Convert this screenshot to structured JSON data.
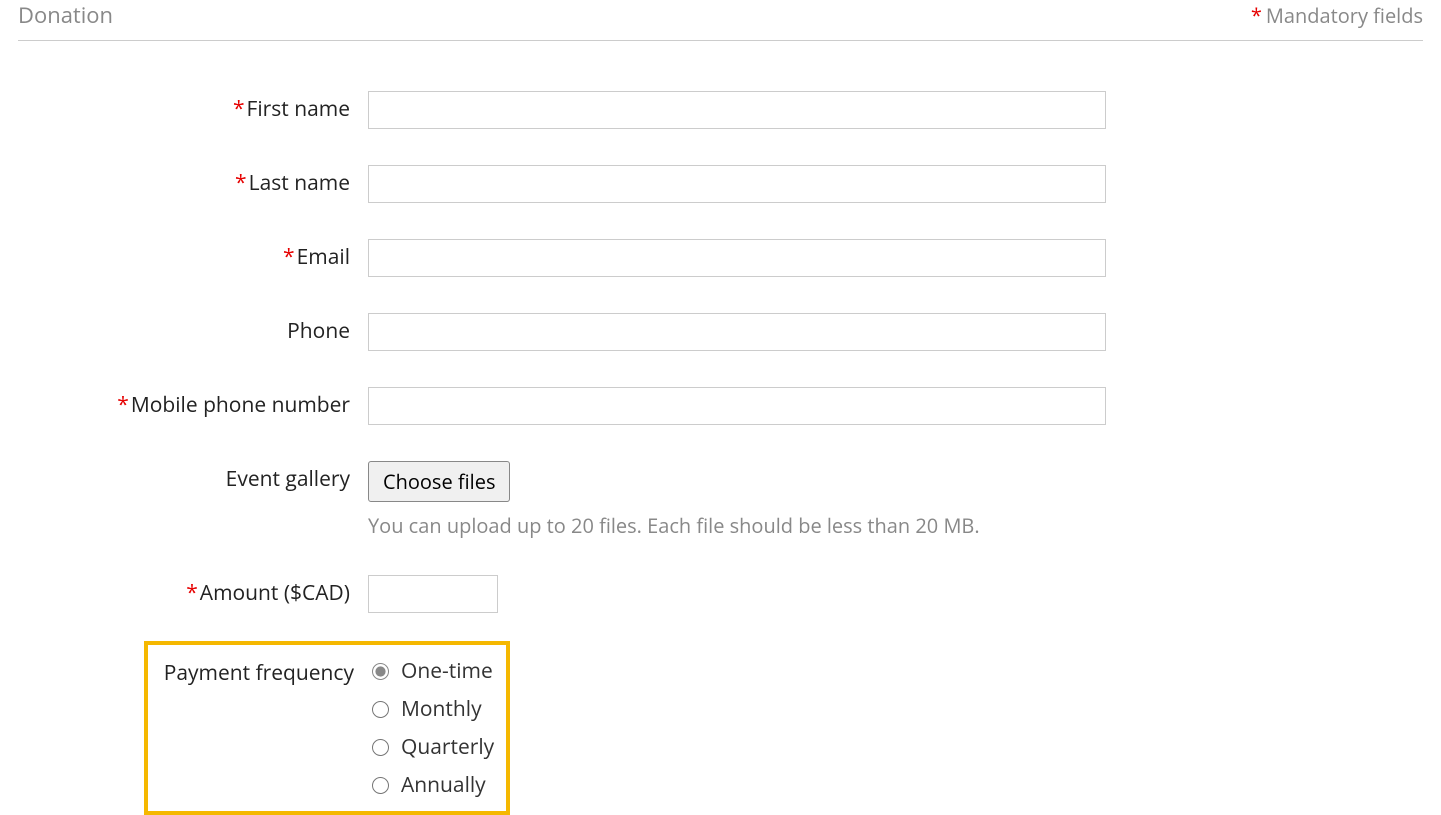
{
  "header": {
    "title": "Donation",
    "mandatory_text": "Mandatory fields"
  },
  "fields": {
    "first_name": {
      "label": "First name",
      "required": true,
      "value": ""
    },
    "last_name": {
      "label": "Last name",
      "required": true,
      "value": ""
    },
    "email": {
      "label": "Email",
      "required": true,
      "value": ""
    },
    "phone": {
      "label": "Phone",
      "required": false,
      "value": ""
    },
    "mobile": {
      "label": "Mobile phone number",
      "required": true,
      "value": ""
    },
    "event_gallery": {
      "label": "Event gallery",
      "button_label": "Choose files",
      "help_text": "You can upload up to 20 files. Each file should be less than 20 MB."
    },
    "amount": {
      "label": "Amount ($CAD)",
      "required": true,
      "value": ""
    },
    "payment_frequency": {
      "label": "Payment frequency",
      "options": [
        {
          "label": "One-time",
          "selected": true
        },
        {
          "label": "Monthly",
          "selected": false
        },
        {
          "label": "Quarterly",
          "selected": false
        },
        {
          "label": "Annually",
          "selected": false
        }
      ]
    }
  }
}
